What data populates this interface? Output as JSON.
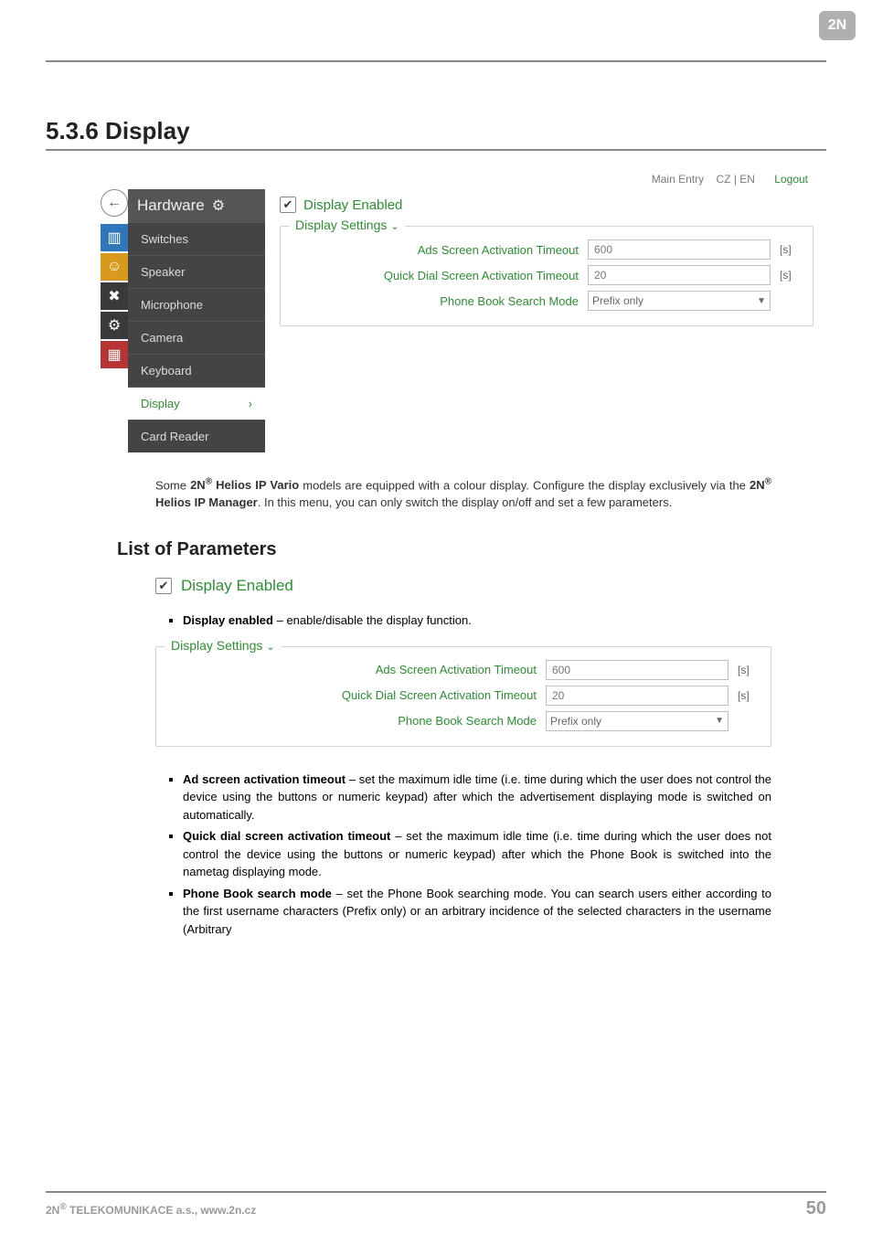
{
  "brand": "2N",
  "section_title": "5.3.6 Display",
  "topbar": {
    "main_entry": "Main Entry",
    "cz": "CZ",
    "en": "EN",
    "sep": "|",
    "logout": "Logout"
  },
  "sidebar": {
    "header": "Hardware",
    "items": [
      {
        "label": "Switches"
      },
      {
        "label": "Speaker"
      },
      {
        "label": "Microphone"
      },
      {
        "label": "Camera"
      },
      {
        "label": "Keyboard"
      },
      {
        "label": "Display",
        "active": true,
        "chev": "›"
      },
      {
        "label": "Card Reader"
      }
    ]
  },
  "panel": {
    "display_enabled_label": "Display Enabled",
    "fs_title": "Display Settings",
    "rows": {
      "ads_label": "Ads Screen Activation Timeout",
      "ads_value": "600",
      "ads_units": "[s]",
      "quick_label": "Quick Dial Screen Activation Timeout",
      "quick_value": "20",
      "quick_units": "[s]",
      "mode_label": "Phone Book Search Mode",
      "mode_value": "Prefix only"
    }
  },
  "para1_a": "Some ",
  "para1_b": "2N",
  "para1_sup": "®",
  "para1_c": " Helios IP Vario",
  "para1_d": " models are equipped with a colour display. Configure the display exclusively via the ",
  "para1_e": "2N",
  "para1_f": " Helios IP Manager",
  "para1_g": ". In this menu, you can only switch the display on/off and set a few parameters.",
  "subhead": "List of Parameters",
  "display_enabled_big": "Display Enabled",
  "bullet_display": {
    "lbl": "Display enabled",
    "txt": " – enable/disable the display function."
  },
  "lower_fs_title": "Display Settings",
  "bullet_ad": {
    "lbl": "Ad screen activation timeout",
    "txt": " – set the maximum idle time (i.e. time during which the user does not control the device using the buttons or numeric keypad) after which the advertisement displaying mode is switched on automatically."
  },
  "bullet_qd": {
    "lbl": "Quick dial screen activation timeout",
    "txt": " – set the maximum idle time (i.e. time during which the user does not control the device using the buttons or numeric keypad) after which the Phone Book is switched into the nametag displaying mode."
  },
  "bullet_mode": {
    "lbl": "Phone Book search mode",
    "txt": " – set the Phone Book searching mode. You can search users either according to the first username characters (Prefix only) or an arbitrary incidence of the selected characters in the username (Arbitrary"
  },
  "footer_left_a": "2N",
  "footer_left_b": " TELEKOMUNIKACE a.s., www.2n.cz",
  "footer_page": "50"
}
